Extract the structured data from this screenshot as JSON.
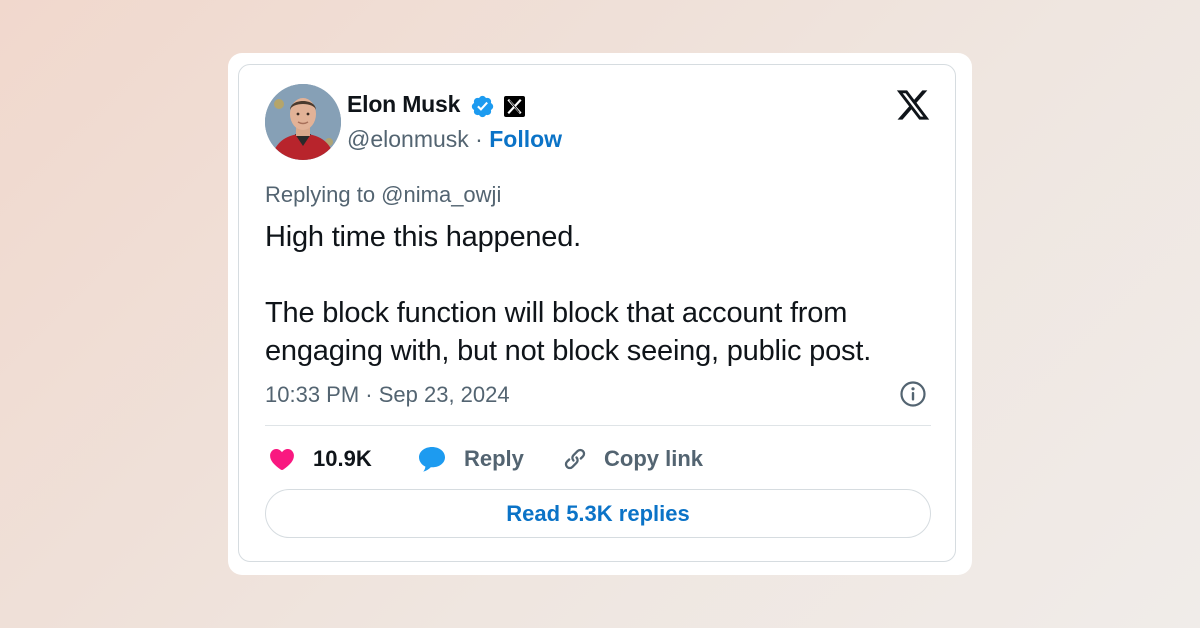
{
  "author": {
    "display_name": "Elon Musk",
    "handle": "@elonmusk",
    "separator": " · ",
    "follow_label": "Follow"
  },
  "tweet": {
    "replying_to": "Replying to @nima_owji",
    "text_line_1": "High time this happened.",
    "text_line_2": "The block function will block that account from engaging with, but not block seeing, public post.",
    "timestamp": "10:33 PM · Sep 23, 2024"
  },
  "actions": {
    "like_count": "10.9K",
    "reply_label": "Reply",
    "copy_link_label": "Copy link",
    "read_replies_label": "Read 5.3K replies"
  },
  "colors": {
    "verified": "#1d9bf0",
    "link": "#0b73c7",
    "like": "#f91880",
    "reply_bubble": "#1d9bf0",
    "muted": "#536471",
    "text": "#0f1419"
  },
  "icons": {
    "verified": "verified-badge-icon",
    "x_badge": "x-affiliation-icon",
    "x_logo": "x-logo-icon",
    "info": "info-icon",
    "like": "heart-icon",
    "reply": "speech-bubble-icon",
    "copy_link": "link-icon"
  }
}
